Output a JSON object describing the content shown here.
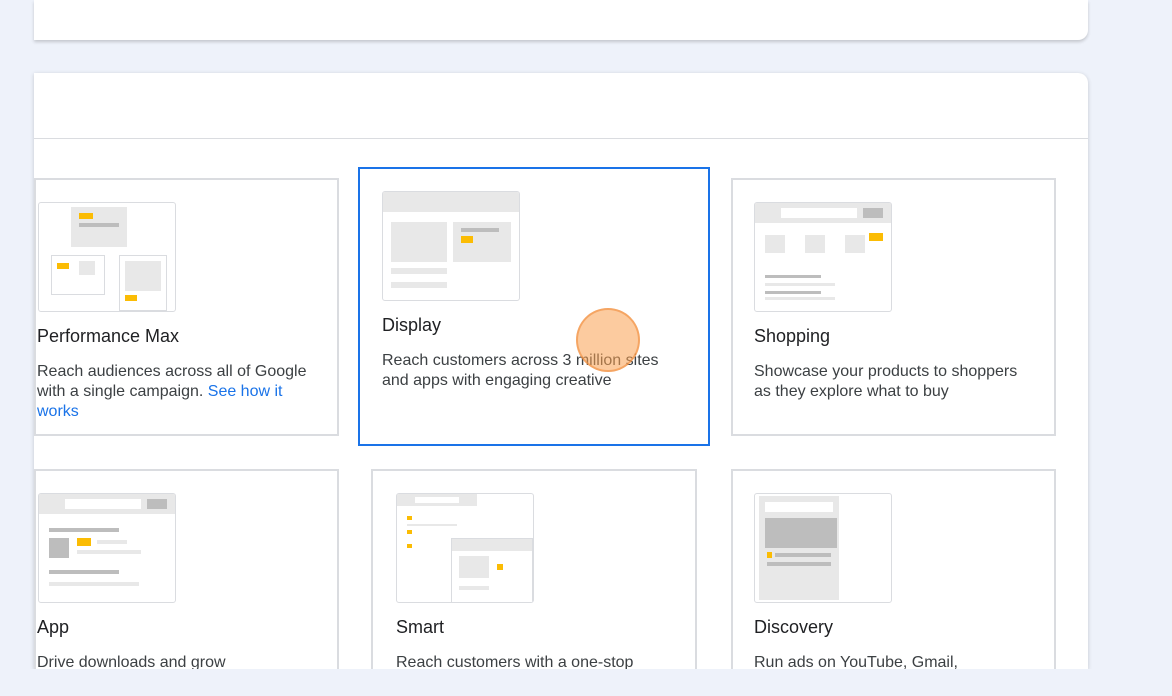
{
  "campaign_types": [
    {
      "title": "Performance Max",
      "description": "Reach audiences across all of Google with a single campaign.",
      "link": "See how it works",
      "selected": false
    },
    {
      "title": "Display",
      "description": "Reach customers across 3 million sites and apps with engaging creative",
      "selected": true
    },
    {
      "title": "Shopping",
      "description": "Showcase your products to shoppers as they explore what to buy",
      "selected": false
    },
    {
      "title": "App",
      "description": "Drive downloads and grow",
      "selected": false
    },
    {
      "title": "Smart",
      "description": "Reach customers with a one-stop",
      "selected": false
    },
    {
      "title": "Discovery",
      "description": "Run ads on YouTube, Gmail,",
      "selected": false
    }
  ],
  "colors": {
    "accent": "#1a73e8",
    "highlight": "#fbbc04",
    "background": "#eef2fa"
  }
}
